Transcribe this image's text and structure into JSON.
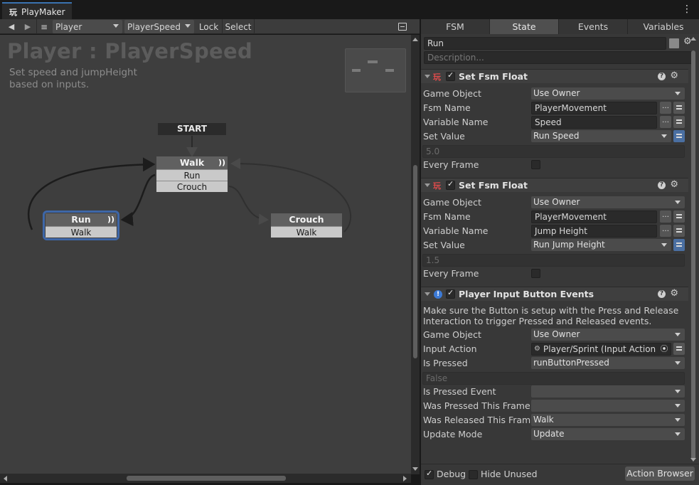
{
  "window": {
    "tab_title": "PlayMaker",
    "tab_icon": "玩"
  },
  "toolbar": {
    "back": "◀",
    "forward": "▶",
    "menu": "≡",
    "gameobject": "Player",
    "fsm": "PlayerSpeed",
    "lock": "Lock",
    "select": "Select"
  },
  "canvas": {
    "title": "Player : PlayerSpeed",
    "description": "Set speed and jumpHeight based on inputs.",
    "start_label": "START",
    "states": [
      {
        "name": "Walk",
        "events": [
          "Run",
          "Crouch"
        ]
      },
      {
        "name": "Run",
        "events": [
          "Walk"
        ]
      },
      {
        "name": "Crouch",
        "events": [
          "Walk"
        ]
      }
    ],
    "wave_glyph": "))"
  },
  "inspector": {
    "tabs": [
      "FSM",
      "State",
      "Events",
      "Variables"
    ],
    "active_tab": "State",
    "state_name": "Run",
    "description_placeholder": "Description...",
    "actions": [
      {
        "title": "Set Fsm Float",
        "icon": "playmaker-icon",
        "rows": [
          {
            "label": "Game Object",
            "value": "Use Owner"
          },
          {
            "label": "Fsm Name",
            "value": "PlayerMovement"
          },
          {
            "label": "Variable Name",
            "value": "Speed"
          },
          {
            "label": "Set Value",
            "value": "Run Speed"
          },
          {
            "label": "",
            "value": "5.0"
          },
          {
            "label": "Every Frame",
            "value": ""
          }
        ]
      },
      {
        "title": "Set Fsm Float",
        "icon": "playmaker-icon",
        "rows": [
          {
            "label": "Game Object",
            "value": "Use Owner"
          },
          {
            "label": "Fsm Name",
            "value": "PlayerMovement"
          },
          {
            "label": "Variable Name",
            "value": "Jump Height"
          },
          {
            "label": "Set Value",
            "value": "Run Jump Height"
          },
          {
            "label": "",
            "value": "1.5"
          },
          {
            "label": "Every Frame",
            "value": ""
          }
        ]
      },
      {
        "title": "Player Input Button Events",
        "icon": "input-system-icon",
        "note": "Make sure the Button is setup with the Press and Release Interaction to trigger Pressed and Released events.",
        "rows": [
          {
            "label": "Game Object",
            "value": "Use Owner"
          },
          {
            "label": "Input Action",
            "value": "Player/Sprint (Input Action Re"
          },
          {
            "label": "Is Pressed",
            "value": "runButtonPressed"
          },
          {
            "label": "",
            "value": "False"
          },
          {
            "label": "Is Pressed Event",
            "value": ""
          },
          {
            "label": "Was Pressed This Frame",
            "value": ""
          },
          {
            "label": "Was Released This Frame",
            "value": "Walk"
          },
          {
            "label": "Update Mode",
            "value": "Update"
          }
        ]
      }
    ],
    "footer": {
      "debug": "Debug",
      "hide_unused": "Hide Unused",
      "action_browser": "Action Browser"
    }
  },
  "colors": {
    "accent": "#3e67a8",
    "node_header": "#606060",
    "canvas_bg": "#3e3e3e"
  }
}
